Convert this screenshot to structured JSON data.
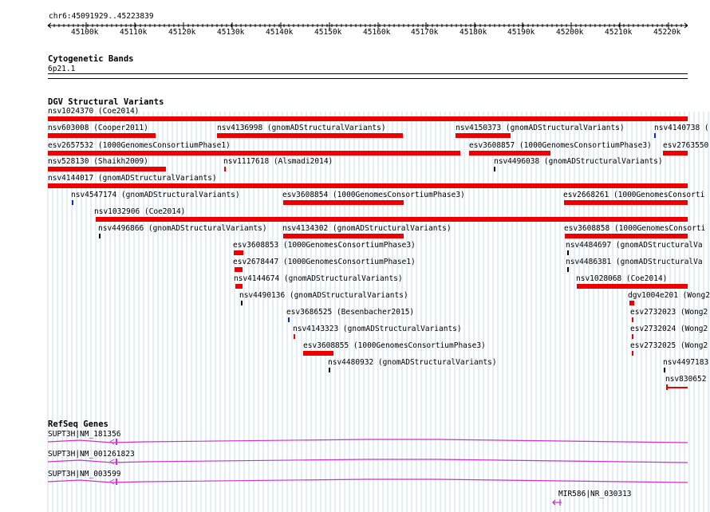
{
  "coord_label": "chr6:45091929..45223839",
  "ruler_ticks": [
    "45100k",
    "45110k",
    "45120k",
    "45130k",
    "45140k",
    "45150k",
    "45160k",
    "45170k",
    "45180k",
    "45190k",
    "45200k",
    "45210k",
    "45220k"
  ],
  "cytoband": {
    "title": "Cytogenetic Bands",
    "band": "6p21.1"
  },
  "dgv": {
    "title": "DGV Structural Variants",
    "features": [
      {
        "label": "nsv1024370 (Coe2014)"
      },
      {
        "label": "nsv603008 (Cooper2011)"
      },
      {
        "label": "nsv4136998 (gnomADStructuralVariants)"
      },
      {
        "label": "nsv4150373 (gnomADStructuralVariants)"
      },
      {
        "label": "nsv4140738 ("
      },
      {
        "label": "esv2657532 (1000GenomesConsortiumPhase1)"
      },
      {
        "label": "esv3608857 (1000GenomesConsortiumPhase3)"
      },
      {
        "label": "esv2763550"
      },
      {
        "label": "nsv528130 (Shaikh2009)"
      },
      {
        "label": "nsv1117618 (Alsmadi2014)"
      },
      {
        "label": "nsv4496038 (gnomADStructuralVariants)"
      },
      {
        "label": "nsv4144017 (gnomADStructuralVariants)"
      },
      {
        "label": "nsv4547174 (gnomADStructuralVariants)"
      },
      {
        "label": "esv3608854 (1000GenomesConsortiumPhase3)"
      },
      {
        "label": "esv2668261 (1000GenomesConsorti"
      },
      {
        "label": "nsv1032906 (Coe2014)"
      },
      {
        "label": "nsv4496866 (gnomADStructuralVariants)"
      },
      {
        "label": "nsv4134302 (gnomADStructuralVariants)"
      },
      {
        "label": "esv3608858 (1000GenomesConsorti"
      },
      {
        "label": "esv3608853 (1000GenomesConsortiumPhase3)"
      },
      {
        "label": "nsv4484697 (gnomADStructuralVa"
      },
      {
        "label": "esv2678447 (1000GenomesConsortiumPhase1)"
      },
      {
        "label": "nsv4486381 (gnomADStructuralVa"
      },
      {
        "label": "nsv4144674 (gnomADStructuralVariants)"
      },
      {
        "label": "nsv1028068 (Coe2014)"
      },
      {
        "label": "nsv4490136 (gnomADStructuralVariants)"
      },
      {
        "label": "dgv1004e201 (Wong2"
      },
      {
        "label": "esv3686525 (Besenbacher2015)"
      },
      {
        "label": "esv2732023 (Wong2"
      },
      {
        "label": "nsv4143323 (gnomADStructuralVariants)"
      },
      {
        "label": "esv2732024 (Wong2"
      },
      {
        "label": "esv3608855 (1000GenomesConsortiumPhase3)"
      },
      {
        "label": "esv2732025 (Wong2"
      },
      {
        "label": "nsv4480932 (gnomADStructuralVariants)"
      },
      {
        "label": "nsv4497183"
      },
      {
        "label": "nsv830652"
      }
    ]
  },
  "refseq": {
    "title": "RefSeq Genes",
    "genes": [
      {
        "label": "SUPT3H|NM_181356"
      },
      {
        "label": "SUPT3H|NM_001261823"
      },
      {
        "label": "SUPT3H|NM_003599"
      },
      {
        "label": "MIR586|NR_030313"
      }
    ]
  },
  "colors": {
    "grid": "#c8dcec",
    "variant": "#ee0000",
    "gene": "#cc33cc",
    "tick_black": "#000000",
    "tick_blue": "#0033cc"
  }
}
